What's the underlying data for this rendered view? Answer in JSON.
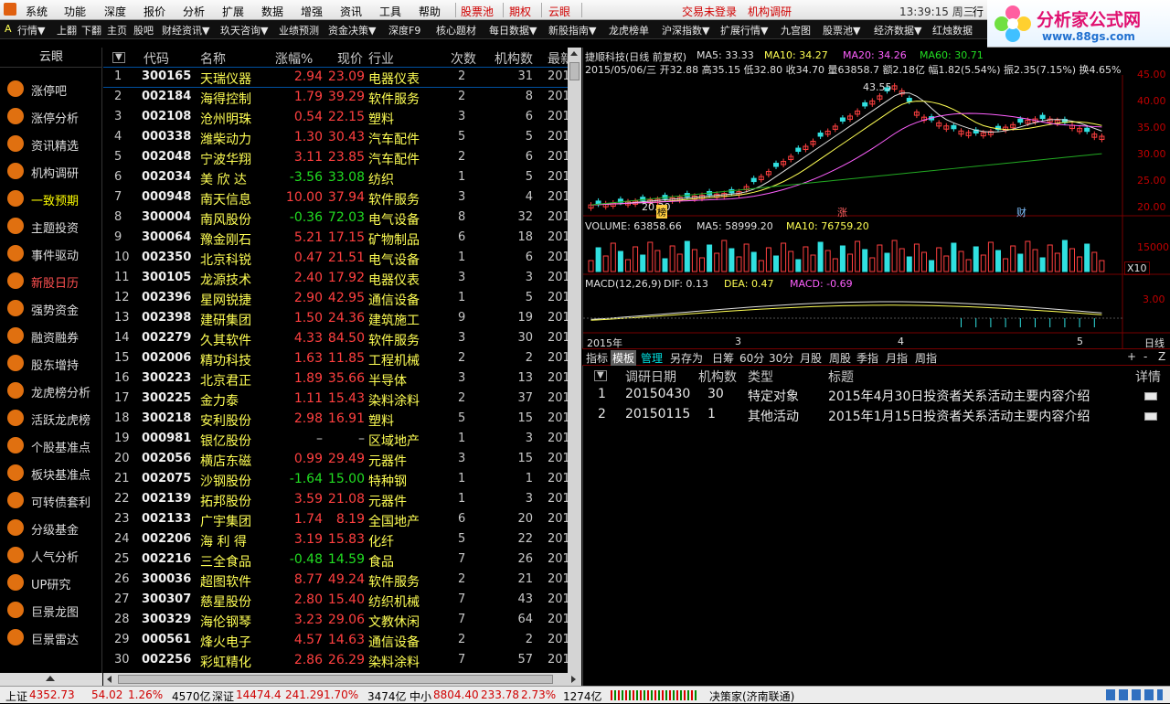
{
  "menu": {
    "items": [
      "系统",
      "功能",
      "深度",
      "报价",
      "分析",
      "扩展",
      "数据",
      "增强",
      "资讯",
      "工具",
      "帮助"
    ],
    "highlight": [
      "股票池",
      "期权",
      "云眼"
    ],
    "login": "交易未登录",
    "research": "机构调研",
    "time": "13:39:15 周三",
    "trade": "行"
  },
  "toolbar": {
    "items": [
      "A",
      "行情▼",
      "上翻",
      "下翻",
      "主页",
      "股吧",
      "财经资讯▼",
      "玖天咨询▼",
      "业绩预测",
      "资金决策▼",
      "深度F9",
      "核心题材",
      "每日数据▼",
      "新股指南▼",
      "龙虎榜单",
      "沪深指数▼",
      "扩展行情▼",
      "九宫图",
      "股票池▼",
      "经济数据▼",
      "红烛数据"
    ]
  },
  "logo": {
    "title": "分析家公式网",
    "url": "www.88gs.com"
  },
  "sidebar": {
    "title": "云眼",
    "items": [
      {
        "label": "涨停吧",
        "icon": "trend-icon"
      },
      {
        "label": "涨停分析",
        "icon": "coin-icon"
      },
      {
        "label": "资讯精选",
        "icon": "target-icon"
      },
      {
        "label": "机构调研",
        "icon": "chart-icon"
      },
      {
        "label": "一致预期",
        "icon": "runner-icon"
      },
      {
        "label": "主题投资",
        "icon": "umbrella-icon"
      },
      {
        "label": "事件驱动",
        "icon": "bag-icon"
      },
      {
        "label": "新股日历",
        "icon": "bulb-icon"
      },
      {
        "label": "强势资金",
        "icon": "case-icon"
      },
      {
        "label": "融资融券",
        "icon": "car-icon"
      },
      {
        "label": "股东增持",
        "icon": "book-icon"
      },
      {
        "label": "龙虎榜分析",
        "icon": "bars-icon"
      },
      {
        "label": "活跃龙虎榜",
        "icon": "person-icon"
      },
      {
        "label": "个股基准点",
        "icon": "grid-icon"
      },
      {
        "label": "板块基准点",
        "icon": "grid-icon"
      },
      {
        "label": "可转债套利",
        "icon": "card-icon"
      },
      {
        "label": "分级基金",
        "icon": "pig-icon"
      },
      {
        "label": "人气分析",
        "icon": "scale-icon"
      },
      {
        "label": "UP研究",
        "icon": "people-icon"
      },
      {
        "label": "巨景龙图",
        "icon": "dragon-icon"
      },
      {
        "label": "巨景雷达",
        "icon": "radar-icon"
      }
    ]
  },
  "table": {
    "headers": [
      "▼",
      "代码",
      "名称",
      "涨幅%",
      "现价",
      "行业",
      "次数",
      "机构数",
      "最新"
    ],
    "rows": [
      [
        "1",
        "300165",
        "天瑞仪器",
        "2.94",
        "23.09",
        "电器仪表",
        "2",
        "31",
        "201"
      ],
      [
        "2",
        "002184",
        "海得控制",
        "1.79",
        "39.29",
        "软件服务",
        "2",
        "8",
        "201"
      ],
      [
        "3",
        "002108",
        "沧州明珠",
        "0.54",
        "22.15",
        "塑料",
        "3",
        "6",
        "201"
      ],
      [
        "4",
        "000338",
        "潍柴动力",
        "1.30",
        "30.43",
        "汽车配件",
        "5",
        "5",
        "201"
      ],
      [
        "5",
        "002048",
        "宁波华翔",
        "3.11",
        "23.85",
        "汽车配件",
        "2",
        "6",
        "201"
      ],
      [
        "6",
        "002034",
        "美 欣 达",
        "-3.56",
        "33.08",
        "纺织",
        "1",
        "5",
        "201"
      ],
      [
        "7",
        "000948",
        "南天信息",
        "10.00",
        "37.94",
        "软件服务",
        "3",
        "4",
        "201"
      ],
      [
        "8",
        "300004",
        "南风股份",
        "-0.36",
        "72.03",
        "电气设备",
        "8",
        "32",
        "201"
      ],
      [
        "9",
        "300064",
        "豫金刚石",
        "5.21",
        "17.15",
        "矿物制品",
        "6",
        "18",
        "201"
      ],
      [
        "10",
        "002350",
        "北京科锐",
        "0.47",
        "21.51",
        "电气设备",
        "1",
        "6",
        "201"
      ],
      [
        "11",
        "300105",
        "龙源技术",
        "2.40",
        "17.92",
        "电器仪表",
        "3",
        "3",
        "201"
      ],
      [
        "12",
        "002396",
        "星网锐捷",
        "2.90",
        "42.95",
        "通信设备",
        "1",
        "5",
        "201"
      ],
      [
        "13",
        "002398",
        "建研集团",
        "1.50",
        "24.36",
        "建筑施工",
        "9",
        "19",
        "201"
      ],
      [
        "14",
        "002279",
        "久其软件",
        "4.33",
        "84.50",
        "软件服务",
        "3",
        "30",
        "201"
      ],
      [
        "15",
        "002006",
        "精功科技",
        "1.63",
        "11.85",
        "工程机械",
        "2",
        "2",
        "201"
      ],
      [
        "16",
        "300223",
        "北京君正",
        "1.89",
        "35.66",
        "半导体",
        "3",
        "13",
        "201"
      ],
      [
        "17",
        "300225",
        "金力泰",
        "1.11",
        "15.43",
        "染料涂料",
        "2",
        "37",
        "201"
      ],
      [
        "18",
        "300218",
        "安利股份",
        "2.98",
        "16.91",
        "塑料",
        "5",
        "15",
        "201"
      ],
      [
        "19",
        "000981",
        "银亿股份",
        "–",
        "–",
        "区域地产",
        "1",
        "3",
        "201"
      ],
      [
        "20",
        "002056",
        "横店东磁",
        "0.99",
        "29.49",
        "元器件",
        "3",
        "15",
        "201"
      ],
      [
        "21",
        "002075",
        "沙钢股份",
        "-1.64",
        "15.00",
        "特种钢",
        "1",
        "1",
        "201"
      ],
      [
        "22",
        "002139",
        "拓邦股份",
        "3.59",
        "21.08",
        "元器件",
        "1",
        "3",
        "201"
      ],
      [
        "23",
        "002133",
        "广宇集团",
        "1.74",
        "8.19",
        "全国地产",
        "6",
        "20",
        "201"
      ],
      [
        "24",
        "002206",
        "海 利 得",
        "3.19",
        "15.83",
        "化纤",
        "5",
        "22",
        "201"
      ],
      [
        "25",
        "002216",
        "三全食品",
        "-0.48",
        "14.59",
        "食品",
        "7",
        "26",
        "201"
      ],
      [
        "26",
        "300036",
        "超图软件",
        "8.77",
        "49.24",
        "软件服务",
        "2",
        "21",
        "201"
      ],
      [
        "27",
        "300307",
        "慈星股份",
        "2.80",
        "15.40",
        "纺织机械",
        "7",
        "43",
        "201"
      ],
      [
        "28",
        "300329",
        "海伦钢琴",
        "3.23",
        "29.06",
        "文教休闲",
        "7",
        "64",
        "201"
      ],
      [
        "29",
        "000561",
        "烽火电子",
        "4.57",
        "14.63",
        "通信设备",
        "2",
        "2",
        "201"
      ],
      [
        "30",
        "002256",
        "彩虹精化",
        "2.86",
        "26.29",
        "染料涂料",
        "7",
        "57",
        "201"
      ]
    ]
  },
  "chart": {
    "title": "捷顺科技(日线 前复权)",
    "ma5": "MA5: 33.33",
    "ma10": "MA10: 34.27",
    "ma20": "MA20: 34.26",
    "ma60": "MA60: 30.71",
    "info": "2015/05/06/三 开32.88 高35.15 低32.80 收34.70 量63858.7 额2.18亿 幅1.82(5.54%) 振2.35(7.15%) 换4.65%",
    "high_label": "43.55",
    "low_label": "20.30",
    "yticks": [
      "45.00",
      "40.00",
      "35.00",
      "30.00",
      "25.00",
      "20.00"
    ],
    "markers": [
      "榜",
      "涨",
      "财"
    ],
    "vol": {
      "label": "VOLUME: 63858.66",
      "ma5": "MA5: 58999.20",
      "ma10": "MA10: 76759.20",
      "tick": "15000",
      "unit": "X10"
    },
    "macd": {
      "label": "MACD(12,26,9)",
      "dif": "DIF: 0.13",
      "dea": "DEA: 0.47",
      "macd": "MACD: -0.69",
      "tick": "3.00"
    },
    "xaxis": [
      "2015年",
      "3",
      "4",
      "5"
    ],
    "period": "日线"
  },
  "tabs": [
    "指标",
    "模板",
    "管理",
    "另存为",
    "日筹",
    "60分",
    "30分",
    "月股",
    "周股",
    "季指",
    "月指",
    "周指"
  ],
  "tab_ctrl": [
    "+",
    "-",
    "Z"
  ],
  "detail": {
    "headers": [
      "▼",
      "调研日期",
      "机构数",
      "类型",
      "标题",
      "详情"
    ],
    "rows": [
      [
        "1",
        "20150430",
        "30",
        "特定对象",
        "2015年4月30日投资者关系活动主要内容介绍"
      ],
      [
        "2",
        "20150115",
        "1",
        "其他活动",
        "2015年1月15日投资者关系活动主要内容介绍"
      ]
    ]
  },
  "status": {
    "sh_label": "上证",
    "sh_val": "4352.73",
    "sh_chg": "54.02",
    "sh_pct": "1.26%",
    "sh_amt": "4570亿",
    "sz_label": "深证",
    "sz_val": "14474.4",
    "sz_chg": "241.29",
    "sz_pct": "1.70%",
    "sz_amt": "3474亿",
    "zx_label": "中小",
    "zx_val": "8804.40",
    "zx_chg": "233.78",
    "zx_pct": "2.73%",
    "zx_amt": "1274亿",
    "broker": "决策家(济南联通)"
  }
}
